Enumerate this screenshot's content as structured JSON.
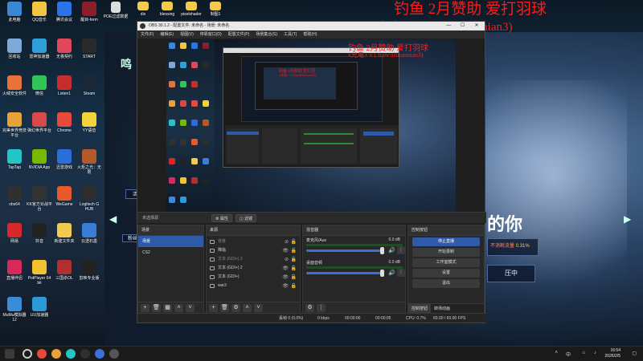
{
  "desktop": {
    "icons": [
      {
        "label": "此电脑",
        "color": "#3c86d8"
      },
      {
        "label": "QQ音乐",
        "color": "#f4c542"
      },
      {
        "label": "腾讯会议",
        "color": "#2b74e8"
      },
      {
        "label": "醒目-ferm",
        "color": "#8a1e2a"
      },
      {
        "label": "回收站",
        "color": "#7da8d8"
      },
      {
        "label": "雷神加速器",
        "color": "#2e9fd8"
      },
      {
        "label": "无畏契约",
        "color": "#e0475a"
      },
      {
        "label": "START",
        "color": "#2a2a2a"
      },
      {
        "label": "火绒安全软件",
        "color": "#e8733a"
      },
      {
        "label": "微信",
        "color": "#31c456"
      },
      {
        "label": "Listen1",
        "color": "#c82d2d"
      },
      {
        "label": "Steam",
        "color": "#1b2838"
      },
      {
        "label": "完美世界竞技平台",
        "color": "#e8a23a"
      },
      {
        "label": "弹幻世界平台",
        "color": "#d84a4a"
      },
      {
        "label": "Chrome",
        "color": "#e54a3a"
      },
      {
        "label": "YY语音",
        "color": "#f2d33a"
      },
      {
        "label": "TapTap",
        "color": "#25c5c5"
      },
      {
        "label": "NVIDIA App",
        "color": "#76b900"
      },
      {
        "label": "迅雷游戏",
        "color": "#2a6fd8"
      },
      {
        "label": "火炬之光：无限",
        "color": "#b45a2a"
      },
      {
        "label": "obs64",
        "color": "#303030"
      },
      {
        "label": "KK官方对战平台",
        "color": "#333333"
      },
      {
        "label": "WeGame",
        "color": "#e85a2a"
      },
      {
        "label": "Logitech G HUB",
        "color": "#2d2d2d"
      },
      {
        "label": "网易",
        "color": "#d8282a"
      },
      {
        "label": "抖音",
        "color": "#222222"
      },
      {
        "label": "新建文件夹",
        "color": "#f3c94e"
      },
      {
        "label": "云透石墨",
        "color": "#3a7cd8"
      },
      {
        "label": "直播伴侣",
        "color": "#d82a5a"
      },
      {
        "label": "PotPlayer 64 bit",
        "color": "#f2c230"
      },
      {
        "label": "三国杀OL",
        "color": "#b03030"
      },
      {
        "label": "剪映专业版",
        "color": "#222222"
      },
      {
        "label": "MuMu模拟器12",
        "color": "#3a8cd8"
      },
      {
        "label": "UU加速器",
        "color": "#2a9ad8"
      }
    ],
    "top_folders": [
      "dix",
      "blessing",
      "pixelshader",
      "制图1"
    ],
    "top_item": "POE过滤数据"
  },
  "overlay": {
    "line1": "钓鱼      2月赞助    爱打羽球",
    "line2": "x允电+ v ( tiancaishaonian3)",
    "small1": "钓鱼   2月赞助   爱打羽球",
    "small2": "x允电+ v ( tiancaishaonian3)",
    "tiny1": "钓鱼  2月赞助  爱打羽",
    "tiny2": "x允电+ v (tiancaishaonian3)"
  },
  "game": {
    "banner": "鸣",
    "title_fragment": "的你",
    "side": "活动",
    "badge": "粉丝",
    "progress_label": "不消耗流量",
    "progress_pct": "0.31%",
    "button": "压中"
  },
  "obs": {
    "title": "OBS 30.1.2 - 配置文件: 未命名 - 场景: 未命名",
    "menu": [
      "文件(F)",
      "编辑(E)",
      "视图(V)",
      "停靠窗口(D)",
      "配置文件(P)",
      "场景集合(S)",
      "工具(T)",
      "帮助(H)"
    ],
    "no_source": "未选择源",
    "properties_btn": "⚙ 属性",
    "filters_btn": "◫ 滤镜",
    "scenes": {
      "title": "场景",
      "items": [
        "场景",
        "CS2"
      ],
      "selected": 0
    },
    "sources": {
      "title": "来源",
      "items": [
        {
          "name": "背景",
          "visible": false
        },
        {
          "name": "降临",
          "visible": true
        },
        {
          "name": "文本 (GDI+) 3",
          "visible": false
        },
        {
          "name": "文本 (GDI+) 2",
          "visible": true
        },
        {
          "name": "文本 (GDI+)",
          "visible": true
        },
        {
          "name": "war3",
          "visible": true
        }
      ]
    },
    "mixer": {
      "title": "混音器",
      "channels": [
        {
          "name": "麦克风/Aux",
          "db": "0.0 dB"
        },
        {
          "name": "桌面音频",
          "db": "0.0 dB"
        }
      ]
    },
    "controls": {
      "title": "控制按钮",
      "buttons": [
        "停止直播",
        "开始录制",
        "工作室模式",
        "设置",
        "退出"
      ],
      "active": 0
    },
    "tabs": [
      "控制按钮",
      "转场动画"
    ],
    "status": {
      "frames": "丢帧 0 (0.0%)",
      "kbps": "0 kbps",
      "rec": "00:00:00",
      "live": "00:00:05",
      "cpu": "CPU: 0.7%",
      "fps": "60.00 / 60.00 FPS"
    }
  },
  "taskbar": {
    "lang": "中",
    "time": "16:54",
    "date": "2026/2/5",
    "apps": [
      "#e54a3a",
      "#e8a23a",
      "#25c5c5",
      "#303030",
      "#3a6fd8",
      "#555555"
    ]
  },
  "colors": {
    "accent": "#2e5aa8",
    "overlay_red": "#ff1a1a",
    "green_meter": "#2a8a3a"
  }
}
